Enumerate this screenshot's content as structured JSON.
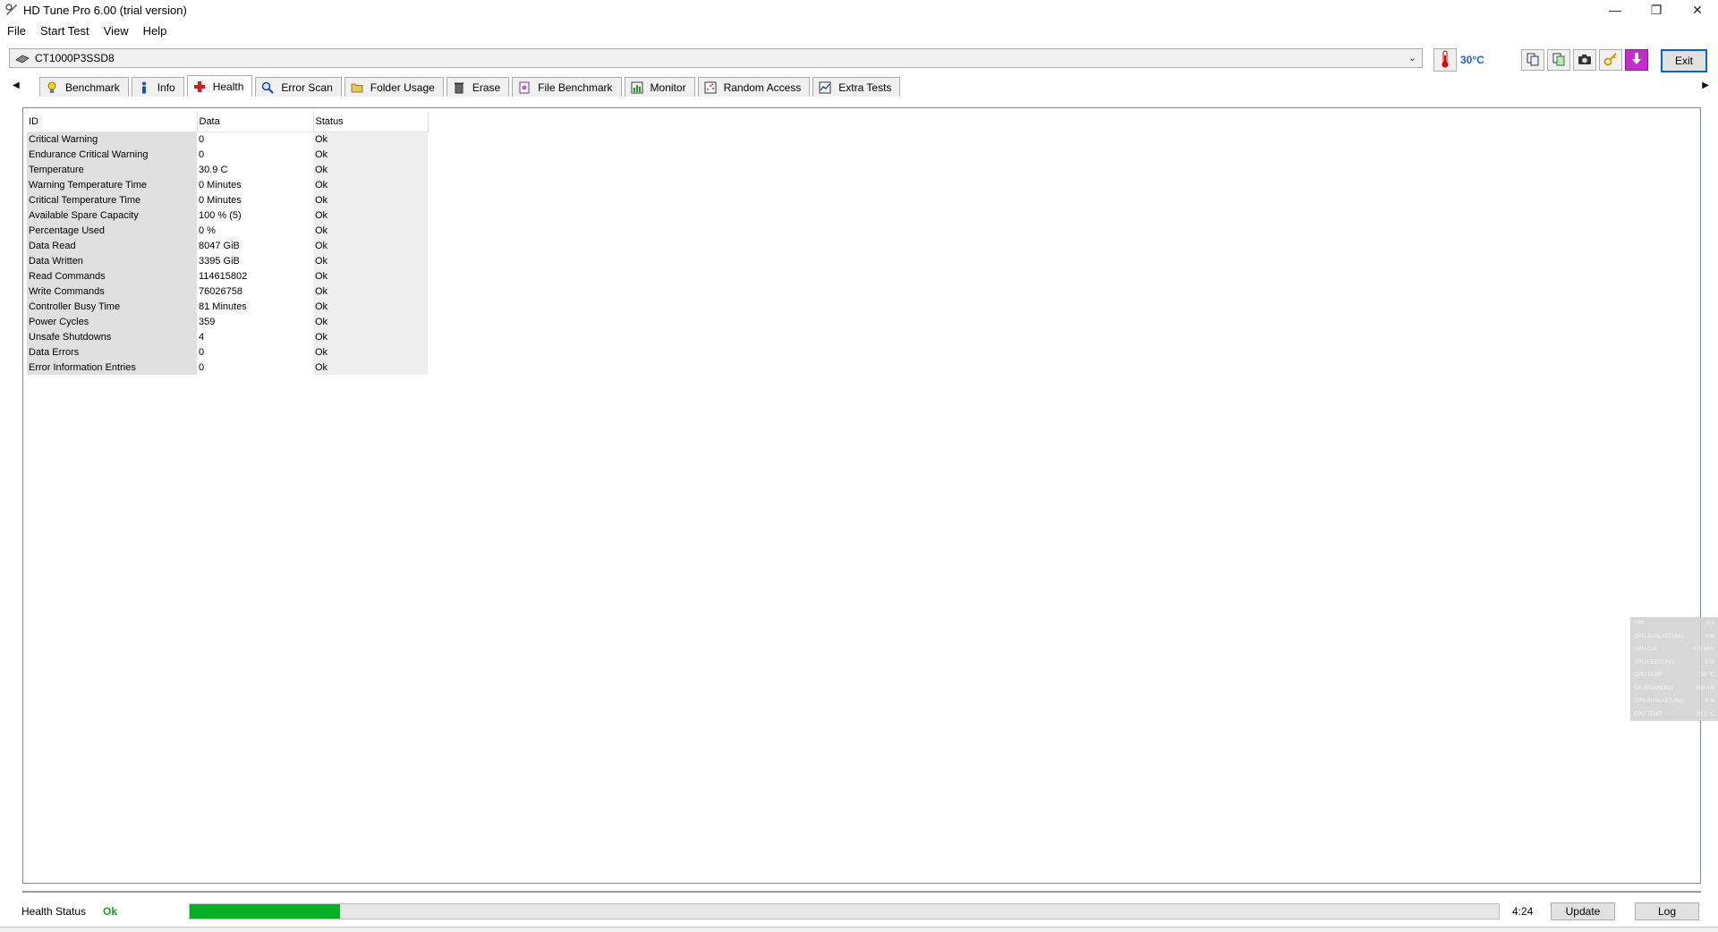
{
  "window": {
    "title": "HD Tune Pro 6.00 (trial version)",
    "minimize_glyph": "—",
    "restore_glyph": "❐",
    "close_glyph": "✕"
  },
  "menu": [
    "File",
    "Start Test",
    "View",
    "Help"
  ],
  "drive": {
    "name": "CT1000P3SSD8"
  },
  "temperature": {
    "text": "30°C",
    "color": "#1a62d6"
  },
  "toolbar": {
    "exit_label": "Exit"
  },
  "tabs": [
    {
      "label": "Benchmark",
      "icon": "lightbulb-icon"
    },
    {
      "label": "Info",
      "icon": "info-icon"
    },
    {
      "label": "Health",
      "icon": "health-cross-icon",
      "active": true
    },
    {
      "label": "Error Scan",
      "icon": "magnifier-icon"
    },
    {
      "label": "Folder Usage",
      "icon": "folder-icon"
    },
    {
      "label": "Erase",
      "icon": "trash-icon"
    },
    {
      "label": "File Benchmark",
      "icon": "file-benchmark-icon"
    },
    {
      "label": "Monitor",
      "icon": "monitor-icon"
    },
    {
      "label": "Random Access",
      "icon": "random-access-icon"
    },
    {
      "label": "Extra Tests",
      "icon": "extra-tests-icon"
    }
  ],
  "health_table": {
    "headers": [
      "ID",
      "Data",
      "Status"
    ],
    "rows": [
      [
        "Critical Warning",
        "0",
        "Ok"
      ],
      [
        "Endurance Critical Warning",
        "0",
        "Ok"
      ],
      [
        "Temperature",
        "30.9 C",
        "Ok"
      ],
      [
        "Warning Temperature Time",
        "0 Minutes",
        "Ok"
      ],
      [
        "Critical Temperature Time",
        "0 Minutes",
        "Ok"
      ],
      [
        "Available Spare Capacity",
        "100 % (5)",
        "Ok"
      ],
      [
        "Percentage Used",
        "0 %",
        "Ok"
      ],
      [
        "Data Read",
        "8047 GiB",
        "Ok"
      ],
      [
        "Data Written",
        "3395 GiB",
        "Ok"
      ],
      [
        "Read Commands",
        "114615802",
        "Ok"
      ],
      [
        "Write Commands",
        "76026758",
        "Ok"
      ],
      [
        "Controller Busy Time",
        "81 Minutes",
        "Ok"
      ],
      [
        "Power Cycles",
        "359",
        "Ok"
      ],
      [
        "Unsafe Shutdowns",
        "4",
        "Ok"
      ],
      [
        "Data Errors",
        "0",
        "Ok"
      ],
      [
        "Error Information Entries",
        "0",
        "Ok"
      ]
    ]
  },
  "osd": [
    [
      "FPS",
      "0,0"
    ],
    [
      "GPU-AUSLASTUNG",
      "0 %"
    ],
    [
      "GPU-CLK",
      "870 MHz"
    ],
    [
      "GPU-LEISTUNG",
      "5 W"
    ],
    [
      "GPU-TEMP",
      "38 °C"
    ],
    [
      "GP-SPANNUNG",
      "660 mV"
    ],
    [
      "CPU-AUSLASTUNG",
      "6 %"
    ],
    [
      "CPU-TEMP",
      "39,2 °C"
    ]
  ],
  "status_bar": {
    "health_label": "Health Status",
    "health_value": "Ok",
    "progress_percent": 11.5,
    "time": "4:24",
    "update_label": "Update",
    "log_label": "Log"
  }
}
